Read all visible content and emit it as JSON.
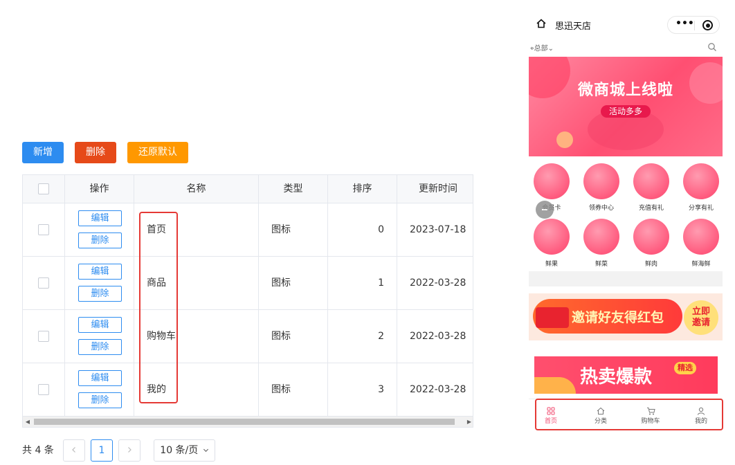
{
  "toolbar": {
    "add_label": "新增",
    "delete_label": "删除",
    "reset_label": "还原默认"
  },
  "table": {
    "headers": {
      "ops": "操作",
      "name": "名称",
      "type": "类型",
      "sort": "排序",
      "updated": "更新时间"
    },
    "edit_label": "编辑",
    "delete_label": "删除",
    "rows": [
      {
        "name": "首页",
        "type": "图标",
        "sort": "0",
        "updated": "2023-07-18"
      },
      {
        "name": "商品",
        "type": "图标",
        "sort": "1",
        "updated": "2022-03-28"
      },
      {
        "name": "购物车",
        "type": "图标",
        "sort": "2",
        "updated": "2022-03-28"
      },
      {
        "name": "我的",
        "type": "图标",
        "sort": "3",
        "updated": "2022-03-28"
      }
    ]
  },
  "pagination": {
    "total": "共 4 条",
    "current_page": "1",
    "page_size": "10 条/页"
  },
  "phone": {
    "title": "思迅天店",
    "location": "总部",
    "banner_title": "微商城上线啦",
    "banner_sub": "活动多多",
    "categories_row1": [
      "会员卡",
      "领券中心",
      "充值有礼",
      "分享有礼"
    ],
    "categories_row2": [
      "鲜果",
      "鲜菜",
      "鲜肉",
      "鲜海鲜"
    ],
    "invite_text": "邀请好友得红包",
    "invite_btn": "立即邀请",
    "hot_text": "热卖爆款",
    "hot_badge": "精选",
    "tabs": [
      "首页",
      "分类",
      "购物车",
      "我的"
    ]
  },
  "colors": {
    "primary": "#2d8cf0",
    "danger": "#e64a19",
    "warning": "#ff9800",
    "highlight": "#e53935",
    "banner": "#ff4f72"
  }
}
